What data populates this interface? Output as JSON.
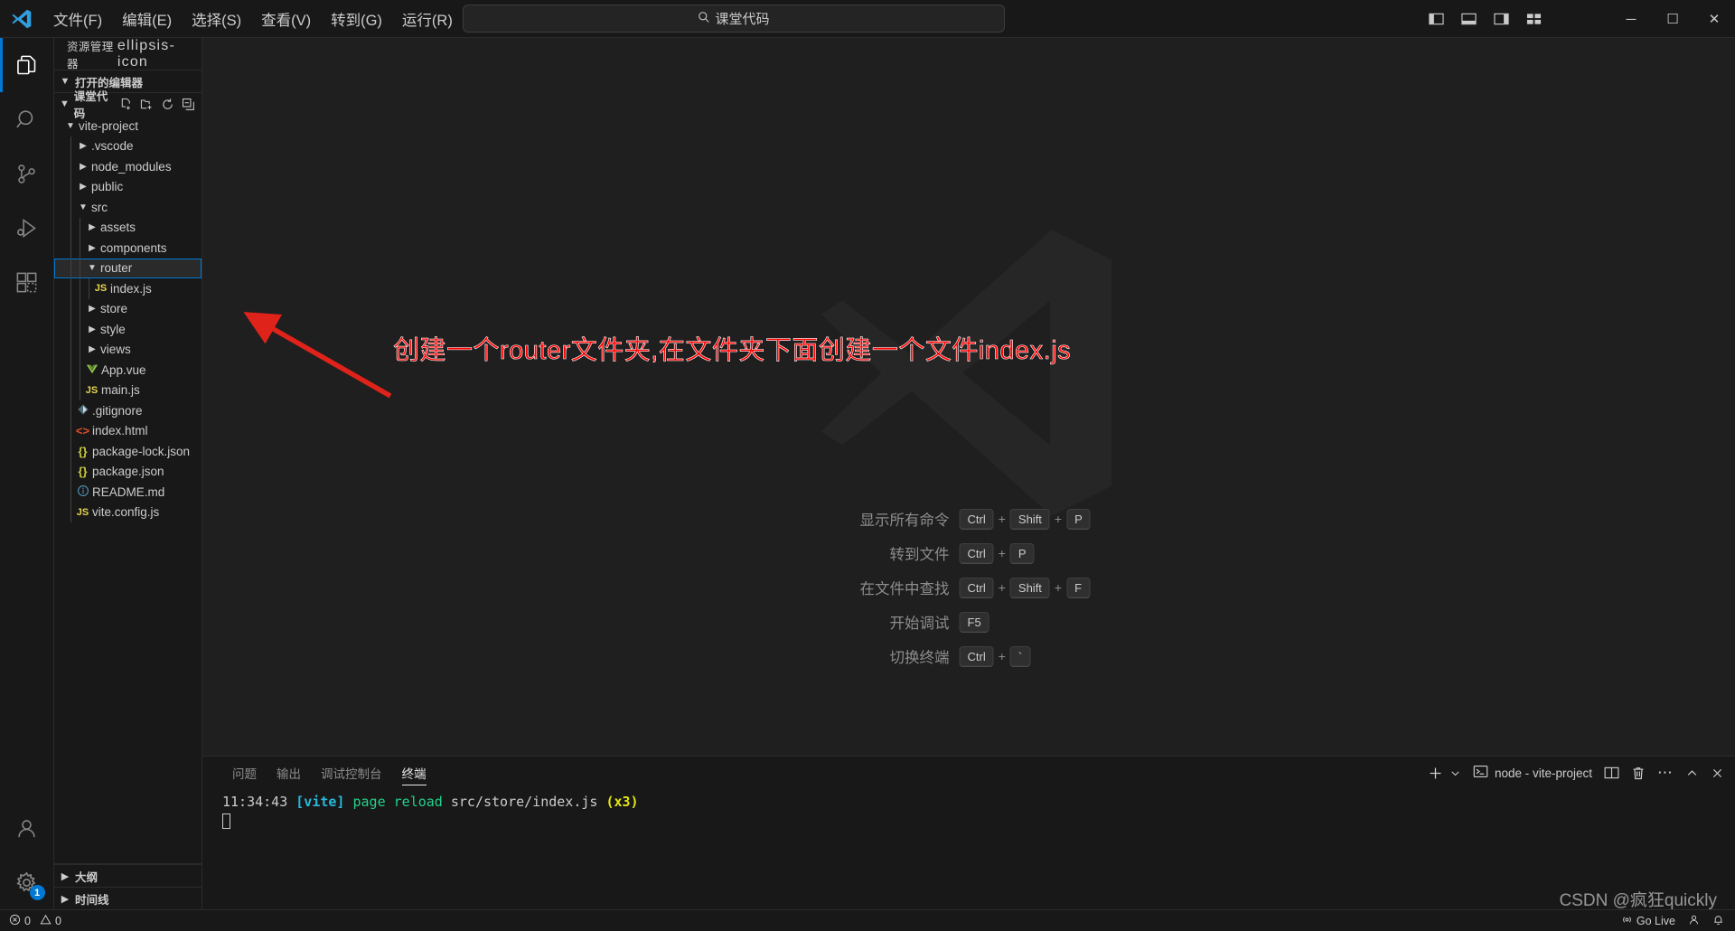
{
  "titlebar": {
    "logo_icon": "vscode-logo-icon",
    "menus": [
      "文件(F)",
      "编辑(E)",
      "选择(S)",
      "查看(V)",
      "转到(G)",
      "运行(R)"
    ],
    "more_label": "…",
    "nav_back_icon": "arrow-left-icon",
    "nav_forward_icon": "arrow-right-icon",
    "search": {
      "icon": "search-icon",
      "value": "课堂代码"
    },
    "layout_buttons": [
      {
        "name": "toggle-primary-sidebar",
        "icon": "layout-sidebar-left-icon"
      },
      {
        "name": "toggle-panel",
        "icon": "layout-panel-icon"
      },
      {
        "name": "toggle-secondary-sidebar",
        "icon": "layout-sidebar-right-icon"
      },
      {
        "name": "customize-layout",
        "icon": "layout-grid-icon"
      }
    ],
    "window_controls": {
      "minimize": "─",
      "maximize": "☐",
      "close": "✕"
    }
  },
  "activitybar": {
    "items": [
      {
        "name": "explorer",
        "icon": "files-icon",
        "active": true
      },
      {
        "name": "search",
        "icon": "search-icon",
        "active": false
      },
      {
        "name": "source-control",
        "icon": "source-control-icon",
        "active": false
      },
      {
        "name": "run-and-debug",
        "icon": "debug-icon",
        "active": false
      },
      {
        "name": "extensions",
        "icon": "extensions-icon",
        "active": false
      }
    ],
    "bottom": [
      {
        "name": "accounts",
        "icon": "account-icon",
        "badge": null
      },
      {
        "name": "manage-settings",
        "icon": "gear-icon",
        "badge": "1"
      }
    ]
  },
  "sidebar": {
    "title": "资源管理器",
    "title_actions_icon": "ellipsis-icon",
    "sections": [
      {
        "label": "打开的编辑器",
        "expanded": true,
        "actions": []
      },
      {
        "label": "课堂代码",
        "expanded": true,
        "actions": [
          "new-file-icon",
          "new-folder-icon",
          "refresh-icon",
          "collapse-all-icon"
        ]
      }
    ],
    "tree": [
      {
        "label": "vite-project",
        "kind": "folder",
        "expanded": true,
        "depth": 1,
        "icon": "chevron-down-icon"
      },
      {
        "label": ".vscode",
        "kind": "folder",
        "expanded": false,
        "depth": 2,
        "icon": "chevron-right-icon"
      },
      {
        "label": "node_modules",
        "kind": "folder",
        "expanded": false,
        "depth": 2,
        "icon": "chevron-right-icon"
      },
      {
        "label": "public",
        "kind": "folder",
        "expanded": false,
        "depth": 2,
        "icon": "chevron-right-icon"
      },
      {
        "label": "src",
        "kind": "folder",
        "expanded": true,
        "depth": 2,
        "icon": "chevron-down-icon"
      },
      {
        "label": "assets",
        "kind": "folder",
        "expanded": false,
        "depth": 3,
        "icon": "chevron-right-icon"
      },
      {
        "label": "components",
        "kind": "folder",
        "expanded": false,
        "depth": 3,
        "icon": "chevron-right-icon"
      },
      {
        "label": "router",
        "kind": "folder",
        "expanded": true,
        "depth": 3,
        "icon": "chevron-down-icon",
        "selected": true
      },
      {
        "label": "index.js",
        "kind": "file",
        "filetype": "js",
        "depth": 4,
        "icon": "js-file-icon"
      },
      {
        "label": "store",
        "kind": "folder",
        "expanded": false,
        "depth": 3,
        "icon": "chevron-right-icon"
      },
      {
        "label": "style",
        "kind": "folder",
        "expanded": false,
        "depth": 3,
        "icon": "chevron-right-icon"
      },
      {
        "label": "views",
        "kind": "folder",
        "expanded": false,
        "depth": 3,
        "icon": "chevron-right-icon"
      },
      {
        "label": "App.vue",
        "kind": "file",
        "filetype": "vue",
        "depth": 3,
        "icon": "vue-file-icon"
      },
      {
        "label": "main.js",
        "kind": "file",
        "filetype": "js",
        "depth": 3,
        "icon": "js-file-icon"
      },
      {
        "label": ".gitignore",
        "kind": "file",
        "filetype": "git",
        "depth": 2,
        "icon": "git-file-icon"
      },
      {
        "label": "index.html",
        "kind": "file",
        "filetype": "html",
        "depth": 2,
        "icon": "html-file-icon"
      },
      {
        "label": "package-lock.json",
        "kind": "file",
        "filetype": "json",
        "depth": 2,
        "icon": "json-file-icon"
      },
      {
        "label": "package.json",
        "kind": "file",
        "filetype": "json",
        "depth": 2,
        "icon": "json-file-icon"
      },
      {
        "label": "README.md",
        "kind": "file",
        "filetype": "md",
        "depth": 2,
        "icon": "markdown-file-icon"
      },
      {
        "label": "vite.config.js",
        "kind": "file",
        "filetype": "js",
        "depth": 2,
        "icon": "js-file-icon"
      }
    ],
    "bottom_sections": [
      {
        "label": "大纲",
        "expanded": false
      },
      {
        "label": "时间线",
        "expanded": false
      }
    ]
  },
  "welcome": {
    "watermark_icon": "vscode-watermark-logo",
    "shortcuts": [
      {
        "label": "显示所有命令",
        "keys": [
          "Ctrl",
          "Shift",
          "P"
        ]
      },
      {
        "label": "转到文件",
        "keys": [
          "Ctrl",
          "P"
        ]
      },
      {
        "label": "在文件中查找",
        "keys": [
          "Ctrl",
          "Shift",
          "F"
        ]
      },
      {
        "label": "开始调试",
        "keys": [
          "F5"
        ]
      },
      {
        "label": "切换终端",
        "keys": [
          "Ctrl",
          "`"
        ]
      }
    ],
    "key_separator": "+"
  },
  "panel": {
    "tabs": [
      {
        "label": "问题",
        "active": false
      },
      {
        "label": "输出",
        "active": false
      },
      {
        "label": "调试控制台",
        "active": false
      },
      {
        "label": "终端",
        "active": true
      }
    ],
    "actions": {
      "new_terminal_icon": "plus-icon",
      "new_terminal_dropdown_icon": "chevron-down-icon",
      "terminal_icon": "terminal-icon",
      "terminal_name": "node - vite-project",
      "split_icon": "split-editor-icon",
      "kill_icon": "trash-icon",
      "more_icon": "ellipsis-icon",
      "maximize_icon": "chevron-up-icon",
      "close_icon": "close-icon"
    },
    "terminal_output": {
      "time": "11:34:43",
      "tag": "[vite]",
      "action": "page reload",
      "path": "src/store/index.js",
      "count": "(x3)"
    }
  },
  "statusbar": {
    "errors_icon": "error-icon",
    "errors": "0",
    "warnings_icon": "warning-icon",
    "warnings": "0",
    "golive_icon": "broadcast-icon",
    "golive_label": "Go Live",
    "account_icon": "person-icon",
    "bell_icon": "bell-icon"
  },
  "annotation": {
    "text": "创建一个router文件夹,在文件夹下面创建一个文件index.js",
    "color": "#ff0000",
    "arrow_color": "#e0231a"
  },
  "watermark": {
    "text": "CSDN @疯狂quickly"
  },
  "colors": {
    "accent": "#0078d4",
    "titlebar_bg": "#181818",
    "editor_bg": "#1f1f1f",
    "sidebar_bg": "#181818",
    "js_yellow": "#e8d44d",
    "vue_green": "#8dc149",
    "html_orange": "#e44d26",
    "json_yellow": "#cbcb41",
    "md_blue": "#519aba"
  }
}
